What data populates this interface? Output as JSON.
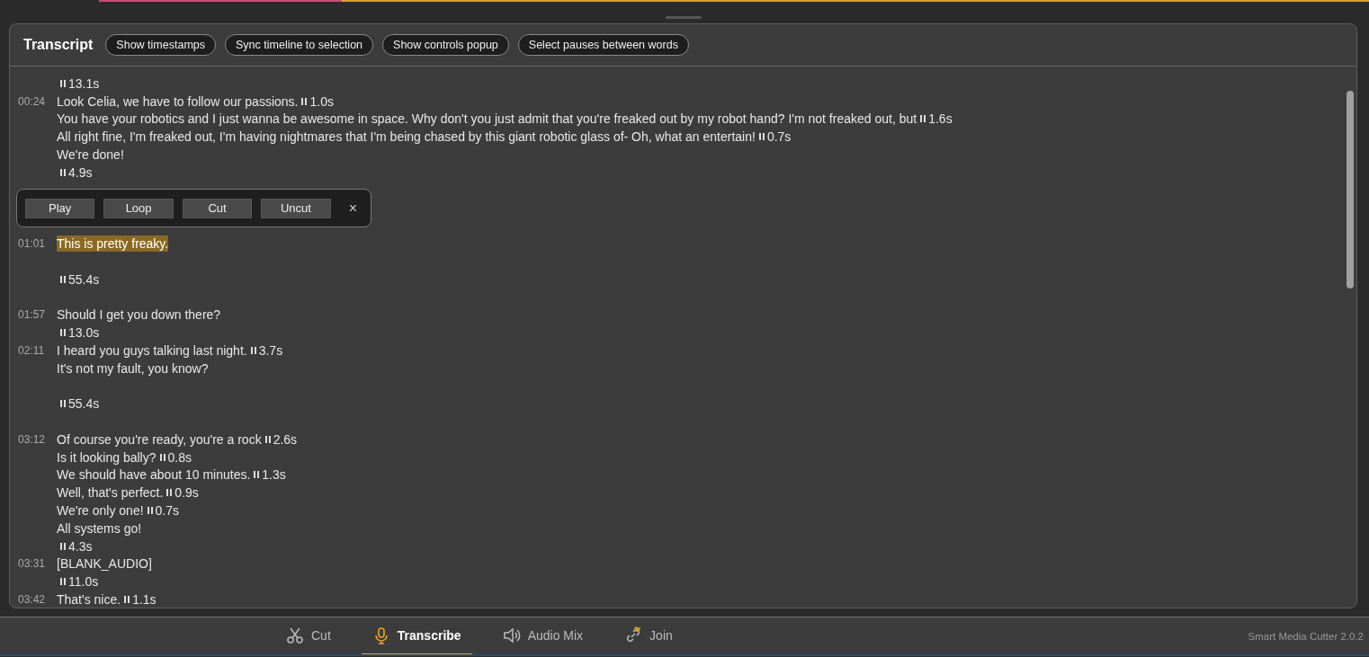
{
  "panel": {
    "title": "Transcript",
    "buttons": [
      "Show timestamps",
      "Sync timeline to selection",
      "Show controls popup",
      "Select pauses between words"
    ]
  },
  "lines": [
    {
      "kind": "pause",
      "pause": "13.1s"
    },
    {
      "kind": "text",
      "time": "00:24",
      "text": "Look Celia, we have to follow our passions.",
      "pause": "1.0s",
      "highlighted": false
    },
    {
      "kind": "text",
      "text": "You have your robotics and I just wanna be awesome in space. Why don't you just admit that you're freaked out by my robot hand? I'm not freaked out, but",
      "pause": "1.6s",
      "highlighted": false
    },
    {
      "kind": "text",
      "text": "All right fine, I'm freaked out, I'm having nightmares that I'm being chased by this giant robotic glass of- Oh, what an entertain!",
      "pause": "0.7s",
      "highlighted": false
    },
    {
      "kind": "text",
      "text": "We're done!",
      "highlighted": false
    },
    {
      "kind": "pause",
      "pause": "4.9s"
    },
    {
      "kind": "gap"
    },
    {
      "kind": "gap"
    },
    {
      "kind": "gap"
    },
    {
      "kind": "text",
      "time": "01:01",
      "text": "This is pretty freaky.",
      "highlighted": true
    },
    {
      "kind": "gap"
    },
    {
      "kind": "pause",
      "pause": "55.4s"
    },
    {
      "kind": "gap"
    },
    {
      "kind": "text",
      "time": "01:57",
      "text": "Should I get you down there?",
      "highlighted": false
    },
    {
      "kind": "pause",
      "pause": "13.0s"
    },
    {
      "kind": "text",
      "time": "02:11",
      "text": "I heard you guys talking last night.",
      "pause": "3.7s",
      "highlighted": false
    },
    {
      "kind": "text",
      "text": "It's not my fault, you know?",
      "highlighted": false
    },
    {
      "kind": "gap"
    },
    {
      "kind": "pause",
      "pause": "55.4s"
    },
    {
      "kind": "gap"
    },
    {
      "kind": "text",
      "time": "03:12",
      "text": "Of course you're ready, you're a rock",
      "pause": "2.6s",
      "highlighted": false
    },
    {
      "kind": "text",
      "text": "Is it looking bally?",
      "pause": "0.8s",
      "highlighted": false
    },
    {
      "kind": "text",
      "text": "We should have about 10 minutes.",
      "pause": "1.3s",
      "highlighted": false
    },
    {
      "kind": "text",
      "text": "Well, that's perfect.",
      "pause": "0.9s",
      "highlighted": false
    },
    {
      "kind": "text",
      "text": "We're only one!",
      "pause": "0.7s",
      "highlighted": false
    },
    {
      "kind": "text",
      "text": "All systems go!",
      "highlighted": false
    },
    {
      "kind": "pause",
      "pause": "4.3s"
    },
    {
      "kind": "text",
      "time": "03:31",
      "text": "[BLANK_AUDIO]",
      "highlighted": false
    },
    {
      "kind": "pause",
      "pause": "11.0s"
    },
    {
      "kind": "text",
      "time": "03:42",
      "text": "That's nice.",
      "pause": "1.1s",
      "highlighted": false
    }
  ],
  "popup": {
    "buttons": [
      "Play",
      "Loop",
      "Cut",
      "Uncut"
    ],
    "close": "×"
  },
  "tabs": [
    {
      "kind": "cut",
      "label": "Cut",
      "selected": false
    },
    {
      "kind": "transcribe",
      "label": "Transcribe",
      "selected": true
    },
    {
      "kind": "audio",
      "label": "Audio Mix",
      "selected": false
    },
    {
      "kind": "join",
      "label": "Join",
      "selected": false
    }
  ],
  "version": "Smart Media Cutter 2.0.2"
}
